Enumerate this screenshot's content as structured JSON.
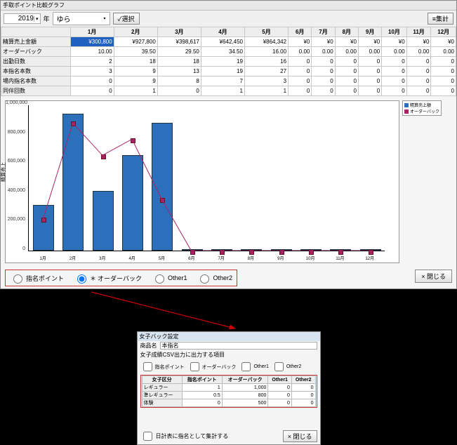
{
  "window_title": "手取ポイント比較グラフ",
  "toolbar": {
    "year": "2019",
    "year_suffix": "年",
    "staff": "ゆら",
    "select_btn": "✓選択",
    "aggregate_btn": "≡集計"
  },
  "months": [
    "1月",
    "2月",
    "3月",
    "4月",
    "5月",
    "6月",
    "7月",
    "8月",
    "9月",
    "10月",
    "11月",
    "12月"
  ],
  "row_labels": [
    "精算売上金額",
    "オーダーバック",
    "出勤日数",
    "本指名本数",
    "場内指名本数",
    "同伴回数"
  ],
  "rows": [
    [
      "¥300,800",
      "¥927,800",
      "¥398,617",
      "¥642,450",
      "¥864,342",
      "¥0",
      "¥0",
      "¥0",
      "¥0",
      "¥0",
      "¥0",
      "¥0"
    ],
    [
      "10.00",
      "39.50",
      "29.50",
      "34.50",
      "16.00",
      "0.00",
      "0.00",
      "0.00",
      "0.00",
      "0.00",
      "0.00",
      "0.00"
    ],
    [
      "2",
      "18",
      "18",
      "19",
      "16",
      "0",
      "0",
      "0",
      "0",
      "0",
      "0",
      "0"
    ],
    [
      "3",
      "9",
      "13",
      "19",
      "27",
      "0",
      "0",
      "0",
      "0",
      "0",
      "0",
      "0"
    ],
    [
      "0",
      "9",
      "8",
      "7",
      "3",
      "0",
      "0",
      "0",
      "0",
      "0",
      "0",
      "0"
    ],
    [
      "0",
      "1",
      "0",
      "1",
      "1",
      "0",
      "0",
      "0",
      "0",
      "0",
      "0",
      "0"
    ]
  ],
  "chart_data": {
    "type": "bar+line",
    "title": "",
    "xlabel": "",
    "ylabel": "精算売上",
    "ylim": [
      0,
      1000000
    ],
    "yticks": [
      0,
      50000,
      100000,
      150000,
      200000,
      250000,
      300000,
      350000,
      400000,
      450000,
      500000,
      550000,
      600000,
      650000,
      700000,
      750000,
      800000,
      850000,
      900000,
      950000,
      1000000
    ],
    "categories": [
      "1月",
      "2月",
      "3月",
      "4月",
      "5月",
      "6月",
      "7月",
      "8月",
      "9月",
      "10月",
      "11月",
      "12月"
    ],
    "series": [
      {
        "name": "精算売上額",
        "type": "bar",
        "values": [
          300800,
          927800,
          398617,
          642450,
          864342,
          0,
          0,
          0,
          0,
          0,
          0,
          0
        ]
      },
      {
        "name": "オーダーバック",
        "type": "line",
        "values": [
          10.0,
          39.5,
          29.5,
          34.5,
          16.0,
          0.0,
          0.0,
          0.0,
          0.0,
          0.0,
          0.0,
          0.0
        ]
      }
    ],
    "y2lim": [
      0,
      45
    ],
    "y2label": "オーダーバック"
  },
  "legend": {
    "bar": "精算売上額",
    "line": "オーダーバック"
  },
  "radios": {
    "a": "指名ポイント",
    "b": "オーダーバック",
    "c": "Other1",
    "d": "Other2",
    "selected": "b"
  },
  "close_btn": "閉じる",
  "dialog": {
    "title": "女子バック設定",
    "product_label": "商品名",
    "product": "本指名",
    "csv_label": "女子成績CSV出力に出力する項目",
    "checks": [
      "指名ポイント",
      "オーダーバック",
      "Other1",
      "Other2"
    ],
    "col0": "女子区分",
    "cols": [
      "指名ポイント",
      "オーダーバック",
      "Other1",
      "Other2"
    ],
    "table_rows": [
      {
        "label": "レギュラー",
        "v": [
          "1",
          "1,000",
          "0",
          "0"
        ]
      },
      {
        "label": "準レギュラー",
        "v": [
          "0.5",
          "800",
          "0",
          "0"
        ]
      },
      {
        "label": "体験",
        "v": [
          "0",
          "500",
          "0",
          "0"
        ]
      }
    ],
    "foot_check": "日計表に指名として集計する",
    "close": "閉じる"
  }
}
